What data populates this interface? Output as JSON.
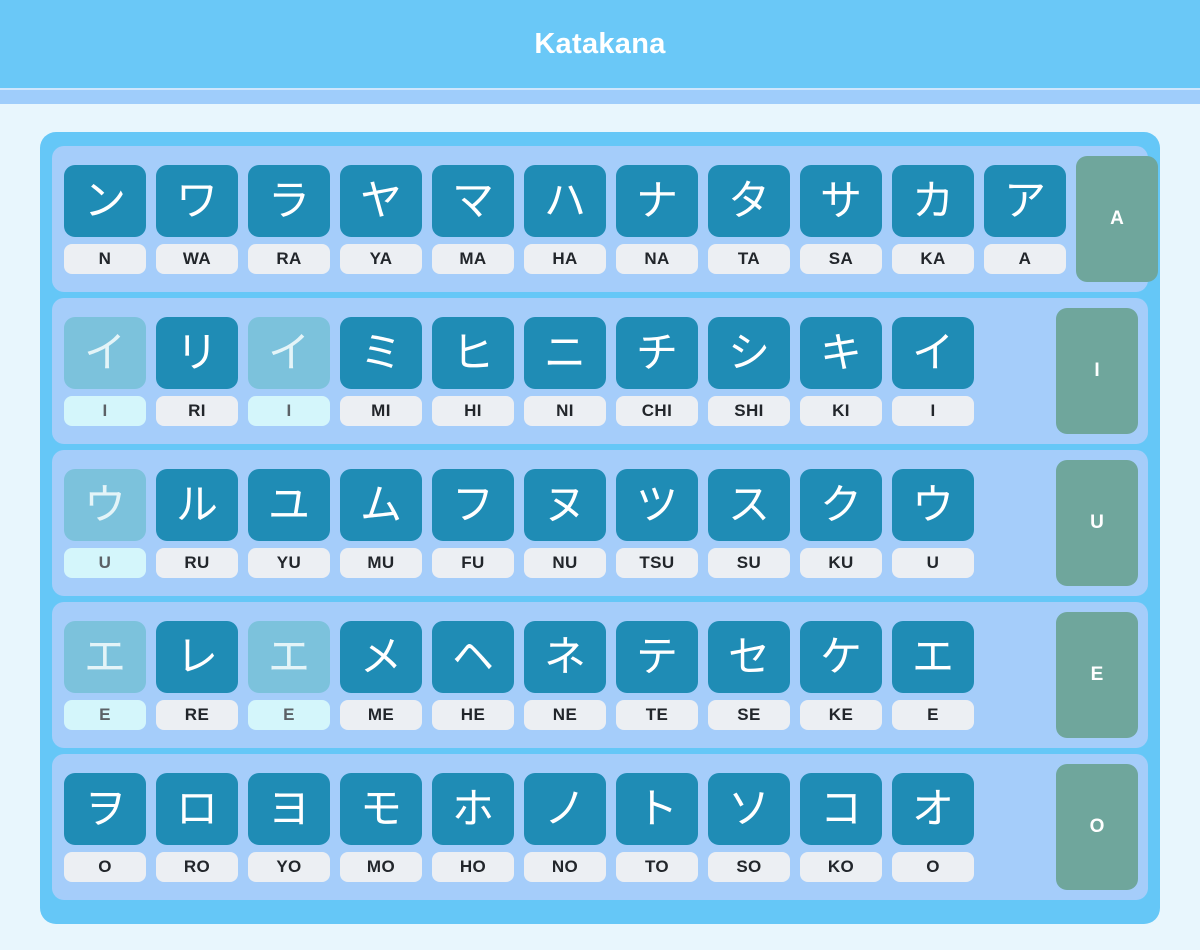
{
  "header": {
    "title": "Katakana"
  },
  "colors": {
    "page_background": "#e8f6fd",
    "header_band": "#6ac8f7",
    "header_underbar": "#9fcdfb",
    "board": "#65c7f7",
    "row_band": "#a5cdfa",
    "kana_tile": "#1f8cb5",
    "kana_tile_dim": "#7cc2dc",
    "romaji_chip": "#eceff3",
    "romaji_chip_dim": "#d4f6fb",
    "vowel_label": "#6fa69c",
    "text_light": "#ffffff",
    "text_dark": "#22262b"
  },
  "chart_data": {
    "type": "table",
    "title": "Katakana",
    "orientation": "right-to-left",
    "row_label_position": "right",
    "rows": [
      {
        "vowel": "A",
        "cells": [
          {
            "kana": "ン",
            "romaji": "N",
            "dim": false
          },
          {
            "kana": "ワ",
            "romaji": "WA",
            "dim": false
          },
          {
            "kana": "ラ",
            "romaji": "RA",
            "dim": false
          },
          {
            "kana": "ヤ",
            "romaji": "YA",
            "dim": false
          },
          {
            "kana": "マ",
            "romaji": "MA",
            "dim": false
          },
          {
            "kana": "ハ",
            "romaji": "HA",
            "dim": false
          },
          {
            "kana": "ナ",
            "romaji": "NA",
            "dim": false
          },
          {
            "kana": "タ",
            "romaji": "TA",
            "dim": false
          },
          {
            "kana": "サ",
            "romaji": "SA",
            "dim": false
          },
          {
            "kana": "カ",
            "romaji": "KA",
            "dim": false
          },
          {
            "kana": "ア",
            "romaji": "A",
            "dim": false
          }
        ]
      },
      {
        "vowel": "I",
        "cells": [
          {
            "kana": "イ",
            "romaji": "I",
            "dim": true
          },
          {
            "kana": "リ",
            "romaji": "RI",
            "dim": false
          },
          {
            "kana": "イ",
            "romaji": "I",
            "dim": true
          },
          {
            "kana": "ミ",
            "romaji": "MI",
            "dim": false
          },
          {
            "kana": "ヒ",
            "romaji": "HI",
            "dim": false
          },
          {
            "kana": "ニ",
            "romaji": "NI",
            "dim": false
          },
          {
            "kana": "チ",
            "romaji": "CHI",
            "dim": false
          },
          {
            "kana": "シ",
            "romaji": "SHI",
            "dim": false
          },
          {
            "kana": "キ",
            "romaji": "KI",
            "dim": false
          },
          {
            "kana": "イ",
            "romaji": "I",
            "dim": false
          }
        ]
      },
      {
        "vowel": "U",
        "cells": [
          {
            "kana": "ウ",
            "romaji": "U",
            "dim": true
          },
          {
            "kana": "ル",
            "romaji": "RU",
            "dim": false
          },
          {
            "kana": "ユ",
            "romaji": "YU",
            "dim": false
          },
          {
            "kana": "ム",
            "romaji": "MU",
            "dim": false
          },
          {
            "kana": "フ",
            "romaji": "FU",
            "dim": false
          },
          {
            "kana": "ヌ",
            "romaji": "NU",
            "dim": false
          },
          {
            "kana": "ツ",
            "romaji": "TSU",
            "dim": false
          },
          {
            "kana": "ス",
            "romaji": "SU",
            "dim": false
          },
          {
            "kana": "ク",
            "romaji": "KU",
            "dim": false
          },
          {
            "kana": "ウ",
            "romaji": "U",
            "dim": false
          }
        ]
      },
      {
        "vowel": "E",
        "cells": [
          {
            "kana": "エ",
            "romaji": "E",
            "dim": true
          },
          {
            "kana": "レ",
            "romaji": "RE",
            "dim": false
          },
          {
            "kana": "エ",
            "romaji": "E",
            "dim": true
          },
          {
            "kana": "メ",
            "romaji": "ME",
            "dim": false
          },
          {
            "kana": "ヘ",
            "romaji": "HE",
            "dim": false
          },
          {
            "kana": "ネ",
            "romaji": "NE",
            "dim": false
          },
          {
            "kana": "テ",
            "romaji": "TE",
            "dim": false
          },
          {
            "kana": "セ",
            "romaji": "SE",
            "dim": false
          },
          {
            "kana": "ケ",
            "romaji": "KE",
            "dim": false
          },
          {
            "kana": "エ",
            "romaji": "E",
            "dim": false
          }
        ]
      },
      {
        "vowel": "O",
        "cells": [
          {
            "kana": "ヲ",
            "romaji": "O",
            "dim": false
          },
          {
            "kana": "ロ",
            "romaji": "RO",
            "dim": false
          },
          {
            "kana": "ヨ",
            "romaji": "YO",
            "dim": false
          },
          {
            "kana": "モ",
            "romaji": "MO",
            "dim": false
          },
          {
            "kana": "ホ",
            "romaji": "HO",
            "dim": false
          },
          {
            "kana": "ノ",
            "romaji": "NO",
            "dim": false
          },
          {
            "kana": "ト",
            "romaji": "TO",
            "dim": false
          },
          {
            "kana": "ソ",
            "romaji": "SO",
            "dim": false
          },
          {
            "kana": "コ",
            "romaji": "KO",
            "dim": false
          },
          {
            "kana": "オ",
            "romaji": "O",
            "dim": false
          }
        ]
      }
    ]
  }
}
